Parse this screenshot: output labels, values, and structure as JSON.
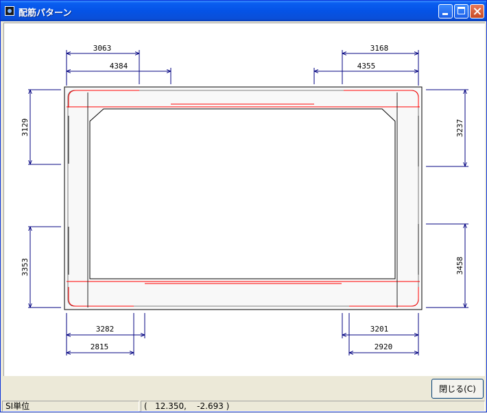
{
  "window": {
    "title": "配筋パターン"
  },
  "drawing": {
    "dims_top_left": [
      "3063",
      "4384"
    ],
    "dims_top_right": [
      "3168",
      "4355"
    ],
    "dims_bottom_left": [
      "3282",
      "2815"
    ],
    "dims_bottom_right": [
      "3201",
      "2920"
    ],
    "dims_left": [
      "3129",
      "3353"
    ],
    "dims_right": [
      "3237",
      "3458"
    ],
    "colors": {
      "dimension": "#000080",
      "rebar": "#ff0000",
      "outline": "#000000"
    }
  },
  "buttons": {
    "close_label": "閉じる(C)"
  },
  "status": {
    "units": "SI単位",
    "coords": "(   12.350,    -2.693 )"
  }
}
